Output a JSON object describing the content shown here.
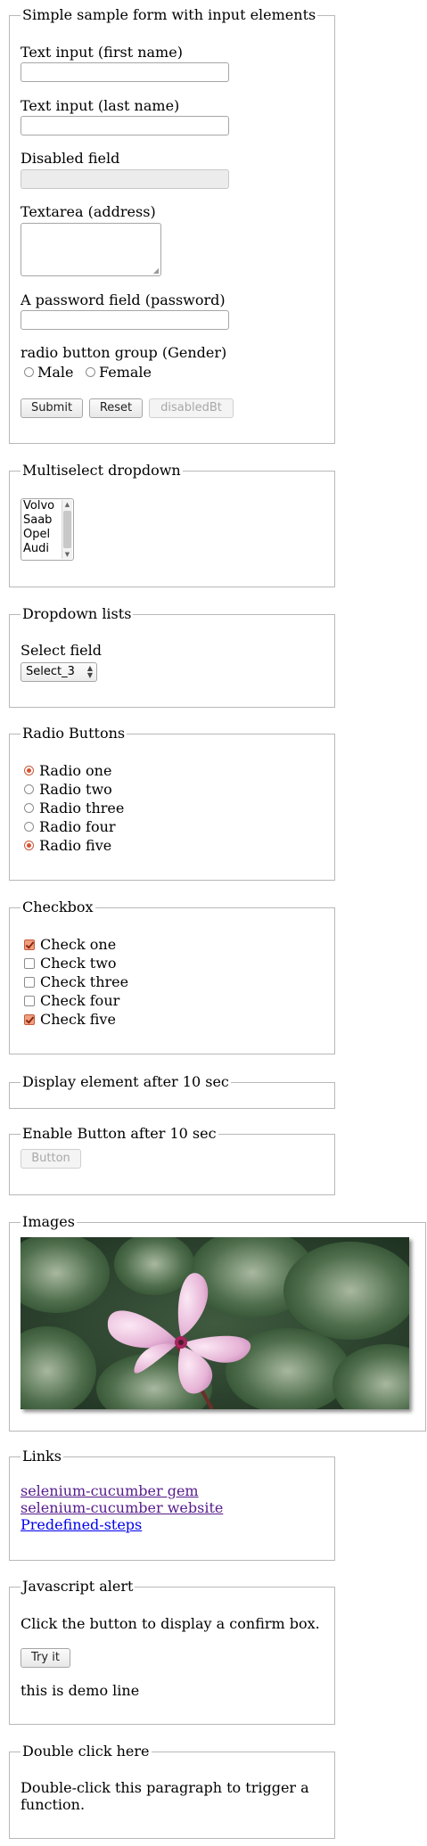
{
  "form": {
    "legend": "Simple sample form with input elements",
    "first_name_label": "Text input (first name)",
    "last_name_label": "Text input (last name)",
    "disabled_label": "Disabled field",
    "textarea_label": "Textarea (address)",
    "password_label": "A password field (password)",
    "gender_label": "radio button group (Gender)",
    "gender_options": [
      "Male",
      "Female"
    ],
    "submit_label": "Submit",
    "reset_label": "Reset",
    "disabled_button_label": "disabledBt"
  },
  "multiselect": {
    "legend": "Multiselect dropdown",
    "options": [
      "Volvo",
      "Saab",
      "Opel",
      "Audi"
    ]
  },
  "dropdown": {
    "legend": "Dropdown lists",
    "label": "Select field",
    "selected": "Select_3"
  },
  "radios": {
    "legend": "Radio Buttons",
    "items": [
      "Radio one",
      "Radio two",
      "Radio three",
      "Radio four",
      "Radio five"
    ],
    "checked": [
      true,
      false,
      false,
      false,
      true
    ]
  },
  "checkbox": {
    "legend": "Checkbox",
    "items": [
      "Check one",
      "Check two",
      "Check three",
      "Check four",
      "Check five"
    ],
    "checked": [
      true,
      false,
      false,
      false,
      true
    ]
  },
  "display_after": {
    "legend": "Display element after 10 sec"
  },
  "enable_after": {
    "legend": "Enable Button after 10 sec",
    "button_label": "Button"
  },
  "images": {
    "legend": "Images",
    "image_icon": "flower-photo"
  },
  "links": {
    "legend": "Links",
    "items": [
      "selenium-cucumber gem",
      "selenium-cucumber website",
      "Predefined-steps"
    ]
  },
  "alert": {
    "legend": "Javascript alert",
    "text": "Click the button to display a confirm box.",
    "button_label": "Try it",
    "demo_line": "this is demo line"
  },
  "dblclick": {
    "legend": "Double click here",
    "text_line1": "Double-click this paragraph to trigger a",
    "text_line2": "function."
  },
  "colors": {
    "accent": "#d8532e",
    "border": "#b8b8b8",
    "link_visited": "#551a8b",
    "link": "#0000ee"
  }
}
